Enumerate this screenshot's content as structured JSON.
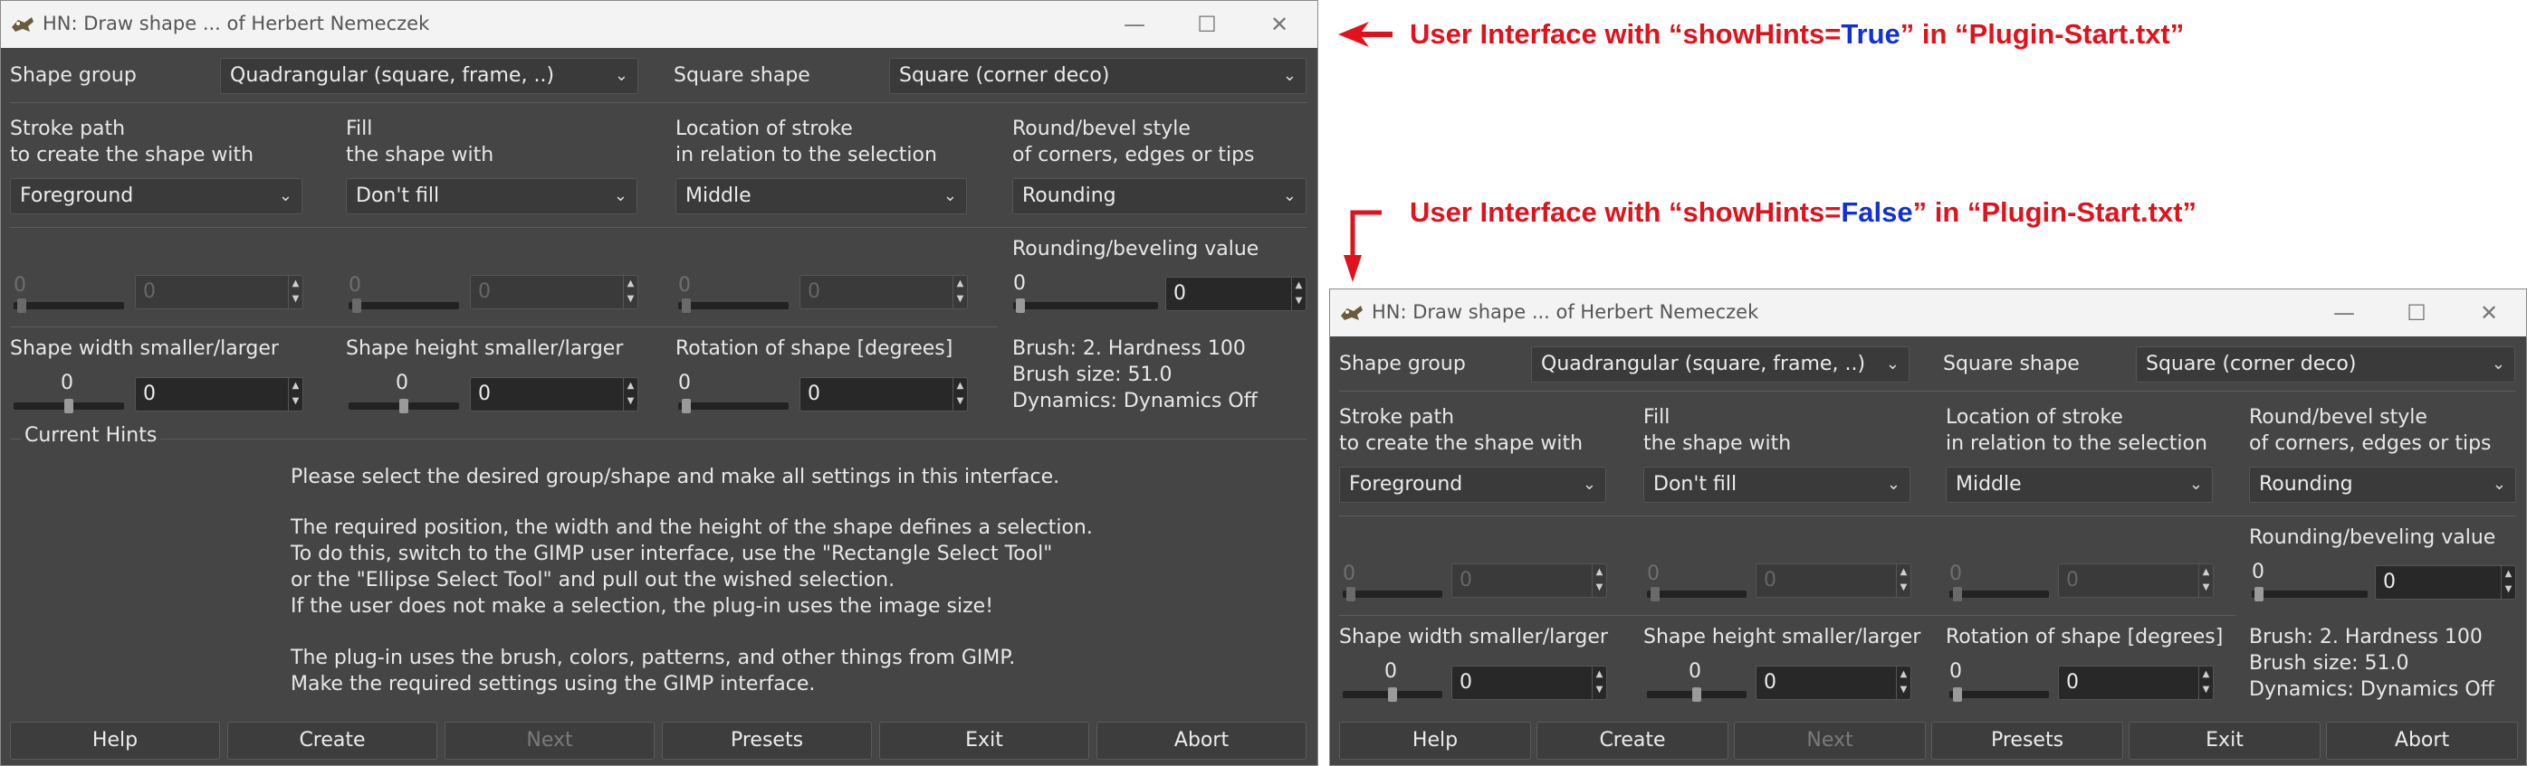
{
  "window1": {
    "title": "HN: Draw shape ... of Herbert Nemeczek",
    "controls": {
      "minimize": "—",
      "maximize": "☐",
      "close": "✕"
    },
    "shape_group_label": "Shape group",
    "shape_group_value": "Quadrangular (square, frame, ..)",
    "square_shape_label": "Square shape",
    "square_shape_value": "Square (corner deco)",
    "stroke_label_1": "Stroke path",
    "stroke_label_2": "to create the shape with",
    "stroke_value": "Foreground",
    "fill_label_1": "Fill",
    "fill_label_2": "the shape with",
    "fill_value": "Don't fill",
    "location_label_1": "Location of stroke",
    "location_label_2": "in relation to the selection",
    "location_value": "Middle",
    "round_label_1": "Round/bevel style",
    "round_label_2": "of corners, edges or tips",
    "round_value": "Rounding",
    "rounding_value_label": "Rounding/beveling value",
    "zero": "0",
    "width_label": "Shape width smaller/larger",
    "height_label": "Shape height smaller/larger",
    "rotation_label": "Rotation of shape [degrees]",
    "brush_line": "Brush: 2. Hardness 100",
    "brush_size": "Brush size: 51.0",
    "dynamics": "Dynamics: Dynamics Off",
    "hints_title": "Current Hints",
    "hints": [
      "Please select the desired group/shape and make all settings in this interface.",
      "The required position, the width and the height of the shape defines a selection.",
      "To do this, switch to the GIMP user interface, use the \"Rectangle Select Tool\"",
      "or the \"Ellipse Select Tool\" and pull out the wished selection.",
      "If the user does not make a selection, the plug-in uses the image size!",
      "The plug-in uses the brush, colors, patterns, and other things from GIMP.",
      "Make the required settings using the GIMP interface."
    ],
    "buttons": {
      "help": "Help",
      "create": "Create",
      "next": "Next",
      "presets": "Presets",
      "exit": "Exit",
      "abort": "Abort"
    }
  },
  "annotations": {
    "a1_pre": "User Interface with “showHints=",
    "a1_val": "True",
    "a1_post": "”  in “Plugin-Start.txt”",
    "a2_pre": "User Interface with “showHints=",
    "a2_val": "False",
    "a2_post": "” in “Plugin-Start.txt”",
    "colors": {
      "red": "#e1121b",
      "blue": "#1230d8"
    }
  }
}
